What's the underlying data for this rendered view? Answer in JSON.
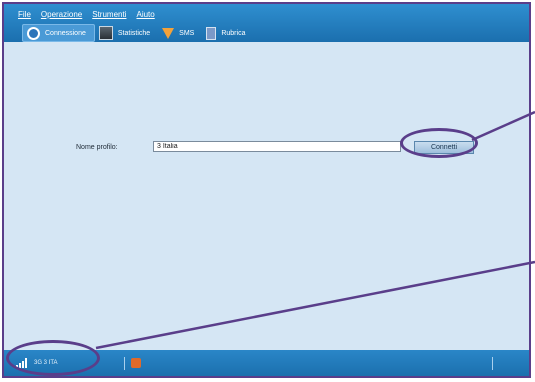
{
  "menu": {
    "items": [
      "File",
      "Operazione",
      "Strumenti",
      "Aiuto"
    ]
  },
  "tabs": [
    {
      "label": "Connessione",
      "icon": "connection-icon"
    },
    {
      "label": "Statistiche",
      "icon": "statistics-icon"
    },
    {
      "label": "SMS",
      "icon": "sms-icon"
    },
    {
      "label": "Rubrica",
      "icon": "address-book-icon"
    }
  ],
  "main": {
    "profile_label": "Nome profilo:",
    "profile_value": "3 Italia",
    "connect_label": "Connetti"
  },
  "status": {
    "network": "3G 3 ITA"
  },
  "colors": {
    "accent": "#1b6fae",
    "highlight": "#5a3e8a",
    "background": "#d5e6f4"
  }
}
